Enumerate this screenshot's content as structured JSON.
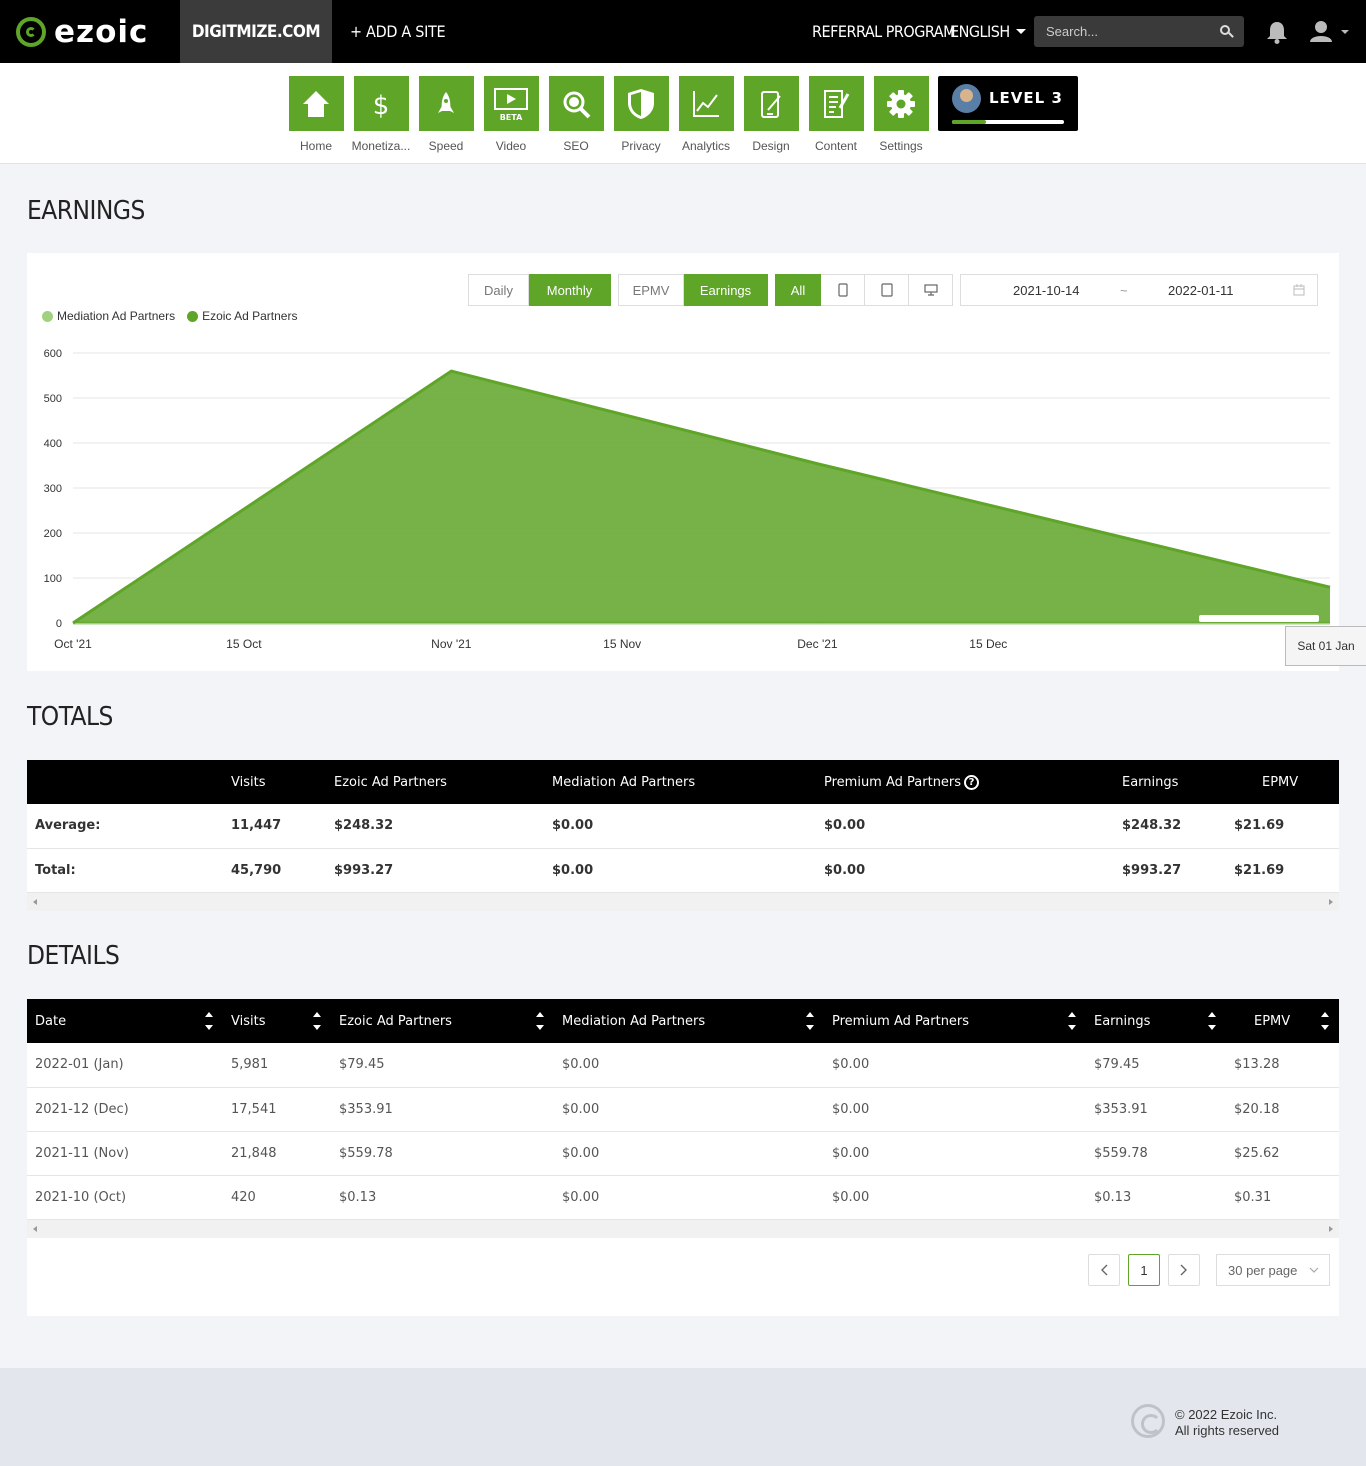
{
  "brand": {
    "logo_text": "ezoic",
    "accent": "#5fa528"
  },
  "topbar": {
    "site": "DIGITMIZE.COM",
    "add_site": "+ ADD A SITE",
    "referral": "REFERRAL PROGRAM",
    "language": "ENGLISH",
    "search_placeholder": "Search..."
  },
  "nav": {
    "items": [
      {
        "label": "Home",
        "icon": "home-icon"
      },
      {
        "label": "Monetiza...",
        "icon": "dollar-icon"
      },
      {
        "label": "Speed",
        "icon": "rocket-icon"
      },
      {
        "label": "Video",
        "icon": "video-icon",
        "badge": "BETA"
      },
      {
        "label": "SEO",
        "icon": "magnifier-icon"
      },
      {
        "label": "Privacy",
        "icon": "shield-icon"
      },
      {
        "label": "Analytics",
        "icon": "line-chart-icon"
      },
      {
        "label": "Design",
        "icon": "design-icon"
      },
      {
        "label": "Content",
        "icon": "document-icon"
      },
      {
        "label": "Settings",
        "icon": "gear-icon"
      }
    ],
    "level": {
      "label": "LEVEL 3",
      "progress": 0.3
    }
  },
  "earnings": {
    "title": "EARNINGS",
    "period_buttons": [
      "Daily",
      "Monthly"
    ],
    "period_active": "Monthly",
    "metric_buttons": [
      "EPMV",
      "Earnings"
    ],
    "metric_active": "Earnings",
    "device_all": "All",
    "date_from": "2021-10-14",
    "date_sep": "~",
    "date_to": "2022-01-11",
    "tooltip": "Sat 01 Jan"
  },
  "chart_data": {
    "type": "area",
    "series": [
      {
        "name": "Mediation Ad Partners",
        "color": "#9fd17f",
        "x": [
          "2021-10-01",
          "2021-11-01",
          "2021-12-01",
          "2022-01-12"
        ],
        "values": [
          0,
          0,
          0,
          0
        ]
      },
      {
        "name": "Ezoic Ad Partners",
        "color": "#5fa528",
        "x": [
          "2021-10-01",
          "2021-11-01",
          "2021-12-01",
          "2022-01-12"
        ],
        "values": [
          0.13,
          559.78,
          353.91,
          79.45
        ]
      }
    ],
    "xticks": [
      {
        "date": "2021-10-01",
        "label": "Oct '21"
      },
      {
        "date": "2021-10-15",
        "label": "15 Oct"
      },
      {
        "date": "2021-11-01",
        "label": "Nov '21"
      },
      {
        "date": "2021-11-15",
        "label": "15 Nov"
      },
      {
        "date": "2021-12-01",
        "label": "Dec '21"
      },
      {
        "date": "2021-12-15",
        "label": "15 Dec"
      }
    ],
    "yticks": [
      0,
      100,
      200,
      300,
      400,
      500,
      600
    ],
    "ylim": [
      0,
      600
    ],
    "xlim": [
      "2021-10-01",
      "2022-01-12"
    ],
    "grid": true,
    "legend": "top-left"
  },
  "totals": {
    "title": "TOTALS",
    "headers": [
      "",
      "Visits",
      "Ezoic Ad Partners",
      "Mediation Ad Partners",
      "Premium Ad Partners",
      "Earnings",
      "EPMV"
    ],
    "rows": [
      [
        "Average:",
        "11,447",
        "$248.32",
        "$0.00",
        "$0.00",
        "$248.32",
        "$21.69"
      ],
      [
        "Total:",
        "45,790",
        "$993.27",
        "$0.00",
        "$0.00",
        "$993.27",
        "$21.69"
      ]
    ]
  },
  "details": {
    "title": "DETAILS",
    "headers": [
      "Date",
      "Visits",
      "Ezoic Ad Partners",
      "Mediation Ad Partners",
      "Premium Ad Partners",
      "Earnings",
      "EPMV"
    ],
    "rows": [
      [
        "2022-01 (Jan)",
        "5,981",
        "$79.45",
        "$0.00",
        "$0.00",
        "$79.45",
        "$13.28"
      ],
      [
        "2021-12 (Dec)",
        "17,541",
        "$353.91",
        "$0.00",
        "$0.00",
        "$353.91",
        "$20.18"
      ],
      [
        "2021-11 (Nov)",
        "21,848",
        "$559.78",
        "$0.00",
        "$0.00",
        "$559.78",
        "$25.62"
      ],
      [
        "2021-10 (Oct)",
        "420",
        "$0.13",
        "$0.00",
        "$0.00",
        "$0.13",
        "$0.31"
      ]
    ]
  },
  "pagination": {
    "current": "1",
    "per_page": "30 per page"
  },
  "footer": {
    "copyright": "© 2022 Ezoic Inc.",
    "rights": "All rights reserved"
  }
}
